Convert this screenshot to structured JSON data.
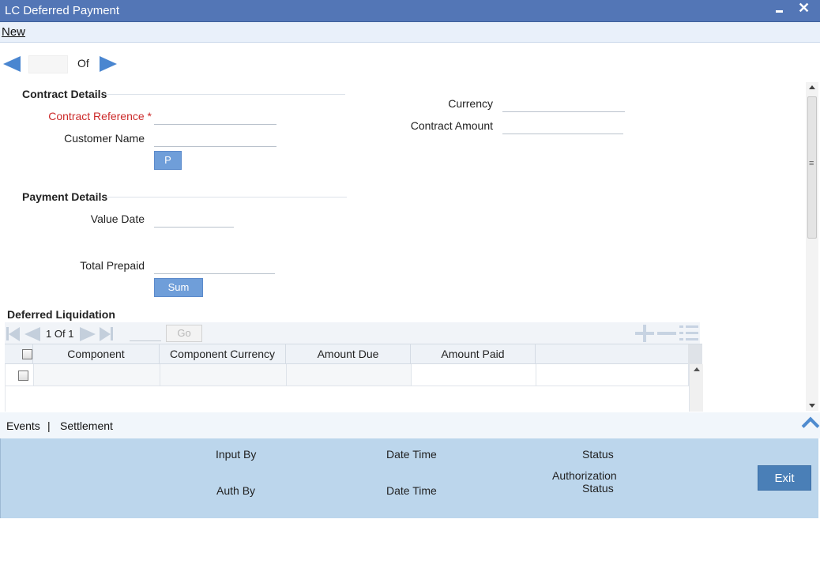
{
  "window": {
    "title": "LC Deferred Payment"
  },
  "menu": {
    "new_label": "New"
  },
  "record_nav": {
    "of_label": "Of"
  },
  "contract_details": {
    "title": "Contract Details",
    "contract_reference_label": "Contract Reference",
    "required_marker": "*",
    "customer_name_label": "Customer Name",
    "p_button_label": "P",
    "currency_label": "Currency",
    "contract_amount_label": "Contract Amount"
  },
  "payment_details": {
    "title": "Payment Details",
    "value_date_label": "Value Date",
    "total_prepaid_label": "Total Prepaid",
    "sum_button_label": "Sum"
  },
  "deferred_liquidation": {
    "title": "Deferred Liquidation",
    "page_current": "1",
    "page_of": "Of",
    "page_total": "1",
    "go_label": "Go",
    "columns": [
      "Component",
      "Component Currency",
      "Amount Due",
      "Amount Paid"
    ]
  },
  "tabs": {
    "events_label": "Events",
    "separator": "|",
    "settlement_label": "Settlement"
  },
  "audit": {
    "input_by_label": "Input By",
    "date_time_label_1": "Date Time",
    "status_label": "Status",
    "auth_by_label": "Auth By",
    "date_time_label_2": "Date Time",
    "authorization_status_line1": "Authorization",
    "authorization_status_line2": "Status",
    "exit_label": "Exit"
  },
  "colors": {
    "titlebar": "#5376b6",
    "accent_button": "#6f9ed9",
    "audit_panel": "#bcd6ec",
    "exit_button": "#4a7fb7",
    "required_label": "#cc2a2a"
  },
  "icons": [
    "minimize-icon",
    "close-icon",
    "prev-record-icon",
    "next-record-icon",
    "first-page-icon",
    "prev-page-icon",
    "next-page-icon",
    "last-page-icon",
    "add-row-icon",
    "delete-row-icon",
    "single-view-icon",
    "collapse-chevron-icon"
  ]
}
